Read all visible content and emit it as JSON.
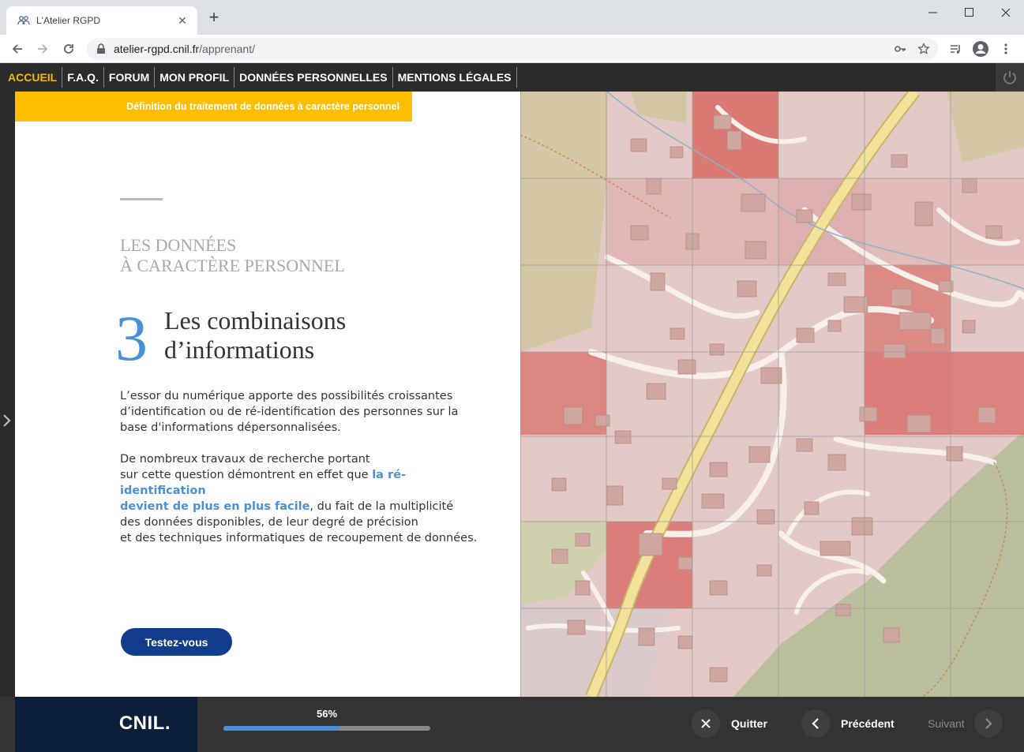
{
  "browser": {
    "tab_title": "L'Atelier RGPD",
    "url_host": "atelier-rgpd.cnil.fr",
    "url_path": "/apprenant/"
  },
  "nav": {
    "items": [
      "ACCUEIL",
      "F.A.Q.",
      "FORUM",
      "MON PROFIL",
      "DONNÉES PERSONNELLES",
      "MENTIONS LÉGALES"
    ],
    "active_index": 0
  },
  "content": {
    "banner": "Définition du traitement de données à caractère personnel",
    "section_line1": "LES DONNÉES",
    "section_line2": "À CARACTÈRE PERSONNEL",
    "number": "3",
    "title_line1": "Les combinaisons",
    "title_line2": "d’informations",
    "para1_l1": "L’essor du numérique apporte des possibilités croissantes",
    "para1_l2": "d’identification ou de ré-identification des personnes sur la",
    "para1_l3": "base d'informations dépersonnalisées.",
    "para2_l1": "De nombreux travaux de recherche portant",
    "para2_l2_a": "sur cette question démontrent en effet que ",
    "para2_l2_hl": "la ré-identification",
    "para2_l3_hl": "devient de plus en plus facile",
    "para2_l3_b": ", du fait de la multiplicité",
    "para2_l4": "des données disponibles, de leur degré de précision",
    "para2_l5": "et des techniques informatiques de recoupement de données.",
    "button": "Testez-vous"
  },
  "footer": {
    "logo": "CNIL.",
    "progress_label": "56%",
    "progress_value": 0.56,
    "quit": "Quitter",
    "previous": "Précédent",
    "next": "Suivant"
  },
  "colors": {
    "accent_yellow": "#ffbf00",
    "accent_blue": "#4a90d9",
    "button_navy": "#123d8c",
    "nav_bg": "#2b2b2b"
  }
}
